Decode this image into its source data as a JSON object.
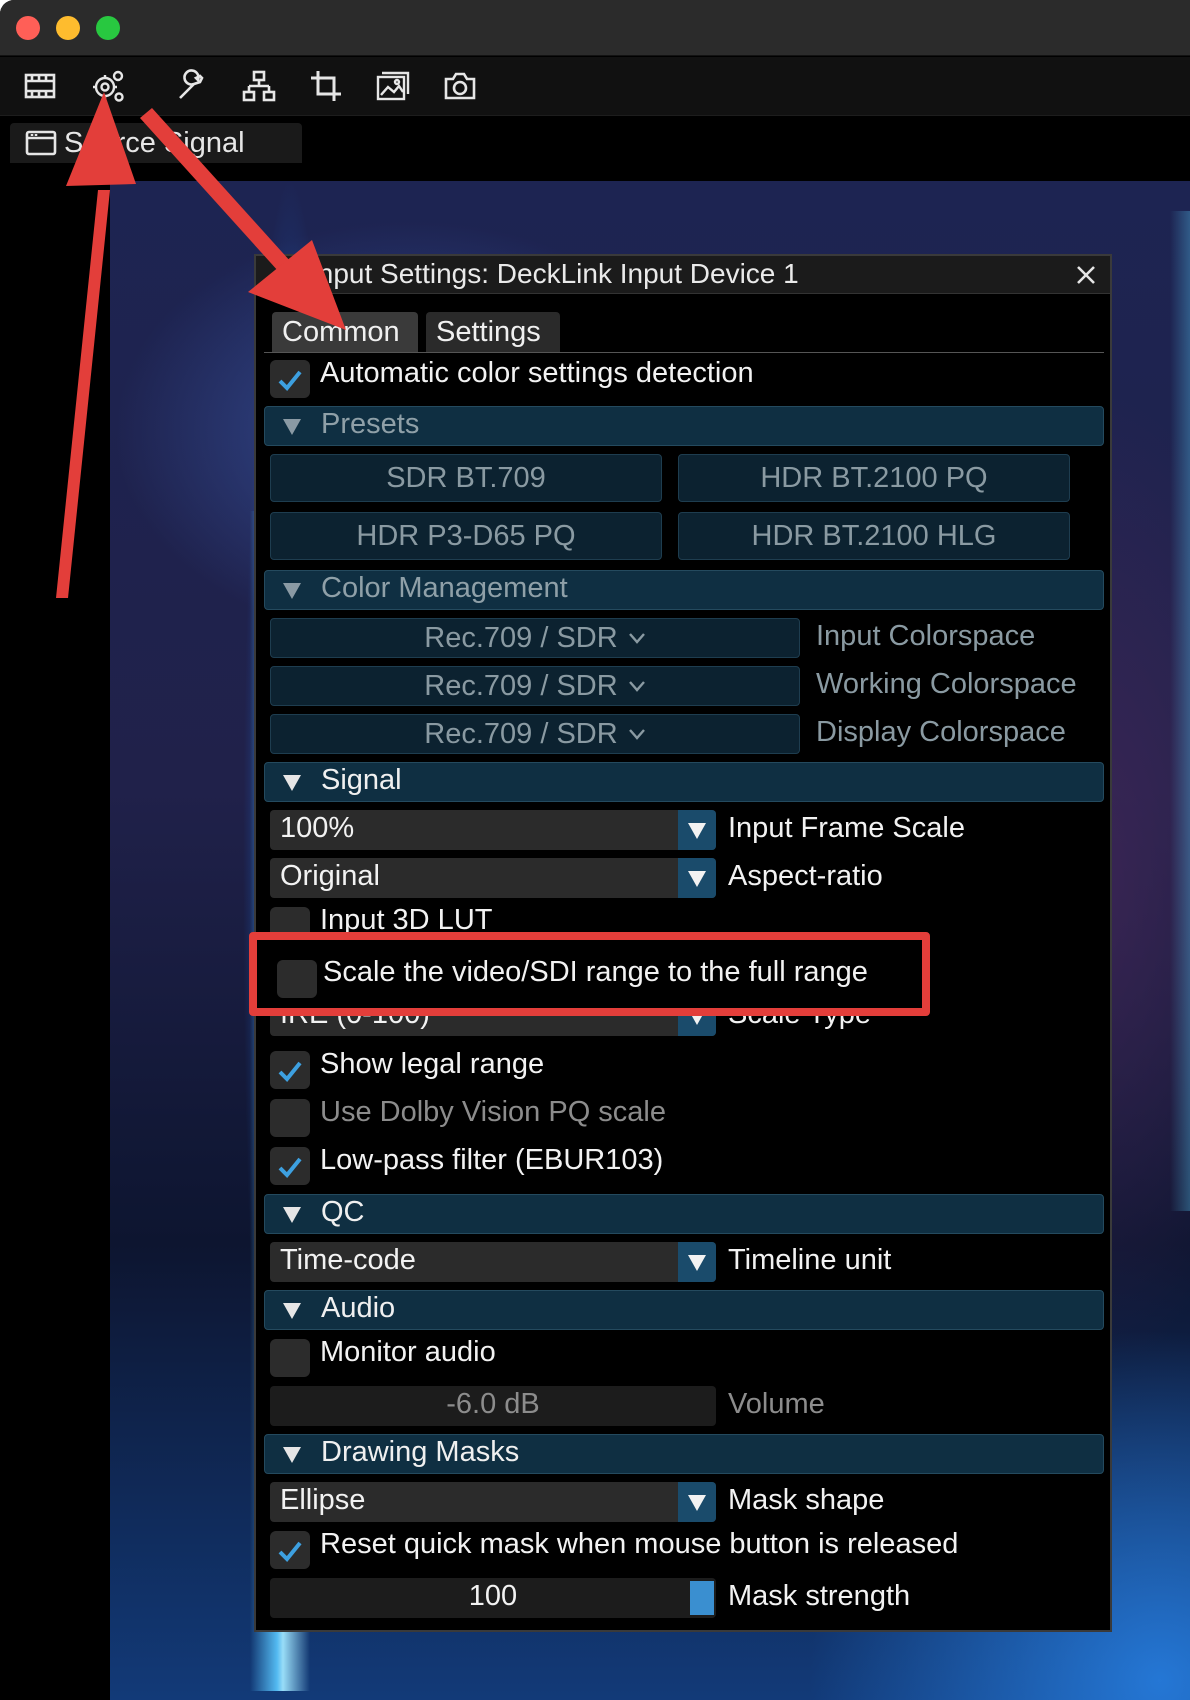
{
  "toolbar": {
    "icons": [
      "timeline-icon",
      "gear-icon",
      "wrench-icon",
      "network-icon",
      "crop-icon",
      "gallery-icon",
      "camera-icon"
    ]
  },
  "document_tab": {
    "label": "Source Signal"
  },
  "dialog": {
    "title": "Input Settings: DeckLink Input Device 1",
    "tabs": {
      "common": "Common",
      "settings": "Settings"
    },
    "auto_color": {
      "label": "Automatic color settings detection",
      "checked": true
    },
    "presets": {
      "section": "Presets",
      "sdr_bt709": "SDR BT.709",
      "hdr_bt2100_pq": "HDR BT.2100 PQ",
      "hdr_p3_d65_pq": "HDR P3-D65 PQ",
      "hdr_bt2100_hlg": "HDR BT.2100 HLG"
    },
    "color_management": {
      "section": "Color Management",
      "input_value": "Rec.709 / SDR",
      "input_label": "Input Colorspace",
      "working_value": "Rec.709 / SDR",
      "working_label": "Working Colorspace",
      "display_value": "Rec.709 / SDR",
      "display_label": "Display Colorspace"
    },
    "signal": {
      "section": "Signal",
      "frame_scale_value": "100%",
      "frame_scale_label": "Input Frame Scale",
      "aspect_value": "Original",
      "aspect_label": "Aspect-ratio",
      "lut_label": "Input 3D LUT",
      "scale_range_label": "Scale the video/SDI range to the full range",
      "scale_type_value": "IRE (0-100)",
      "scale_type_label": "Scale Type",
      "legal_range_label": "Show legal range",
      "dolby_label": "Use Dolby Vision PQ scale",
      "lowpass_label": "Low-pass filter (EBUR103)"
    },
    "qc": {
      "section": "QC",
      "timeline_value": "Time-code",
      "timeline_label": "Timeline unit"
    },
    "audio": {
      "section": "Audio",
      "monitor_label": "Monitor audio",
      "volume_value": "-6.0 dB",
      "volume_label": "Volume"
    },
    "masks": {
      "section": "Drawing Masks",
      "shape_value": "Ellipse",
      "shape_label": "Mask shape",
      "reset_label": "Reset quick mask when mouse button is released",
      "strength_value": "100",
      "strength_label": "Mask strength"
    }
  },
  "colors": {
    "accent": "#1a4b6b",
    "section_bg": "#0f2f42",
    "check": "#3da0e0",
    "annotation": "#e33e3a"
  }
}
